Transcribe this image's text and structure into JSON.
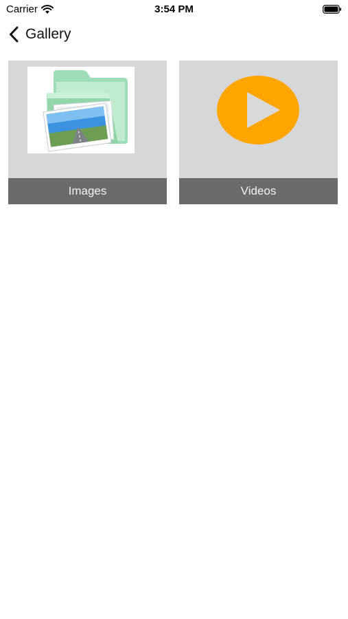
{
  "status_bar": {
    "carrier": "Carrier",
    "time": "3:54 PM",
    "icons": [
      "wifi-icon",
      "battery-icon"
    ]
  },
  "nav": {
    "back_icon": "chevron-left-icon",
    "title": "Gallery"
  },
  "tiles": [
    {
      "label": "Images",
      "icon": "photo-folder-icon",
      "icon_colors": [
        "#a8e0c0",
        "#2d8fd4"
      ]
    },
    {
      "label": "Videos",
      "icon": "play-icon",
      "icon_colors": [
        "#ffa500",
        "#d9d9d9"
      ]
    }
  ],
  "colors": {
    "tile_background": "#d6d7d9",
    "label_bar": "#6b6b6b",
    "label_text": "#f2f2f2"
  }
}
